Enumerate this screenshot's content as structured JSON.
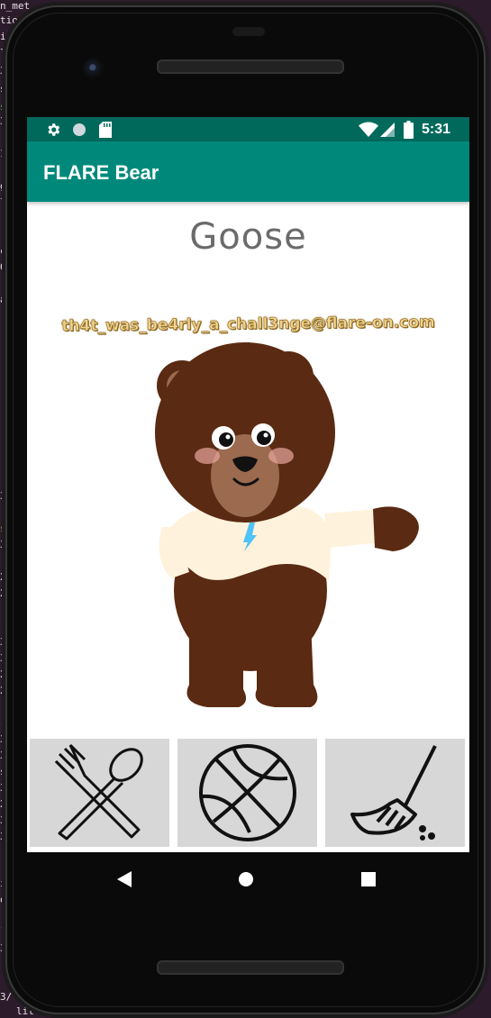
{
  "terminal": {
    "lines": [
      "n_met",
      "tio",
      "i",
      "l",
      "3",
      "s",
      "s",
      "3",
      "1",
      "g",
      "l",
      "c",
      "0",
      "a",
      "3",
      "s",
      "3",
      "2",
      "2",
      "-",
      "3",
      "3",
      "2",
      "2",
      "-",
      "3",
      "3",
      "s",
      "3",
      "2",
      "3",
      "3",
      "i",
      "o",
      "`",
      "3",
      "3/",
      "lit"
    ]
  },
  "status_bar": {
    "time": "5:31",
    "left_icons": [
      "settings-icon",
      "circle-icon",
      "sd-card-icon"
    ],
    "right_icons": [
      "wifi-icon",
      "signal-icon",
      "battery-icon"
    ]
  },
  "app": {
    "title": "FLARE Bear",
    "bear_name": "Goose",
    "flag_text": "th4t_was_be4rly_a_chall3nge@flare-on.com"
  },
  "actions": [
    {
      "name": "feed",
      "icon": "fork-spoon-icon"
    },
    {
      "name": "play",
      "icon": "basketball-icon"
    },
    {
      "name": "clean",
      "icon": "broom-icon"
    }
  ],
  "nav": {
    "back": "back-icon",
    "home": "home-icon",
    "recents": "recents-icon"
  },
  "colors": {
    "status_bar": "#00695c",
    "app_bar": "#00897b",
    "bear_brown": "#5a2a12",
    "shirt": "#fff2dc",
    "button_bg": "#d7d7d7"
  }
}
